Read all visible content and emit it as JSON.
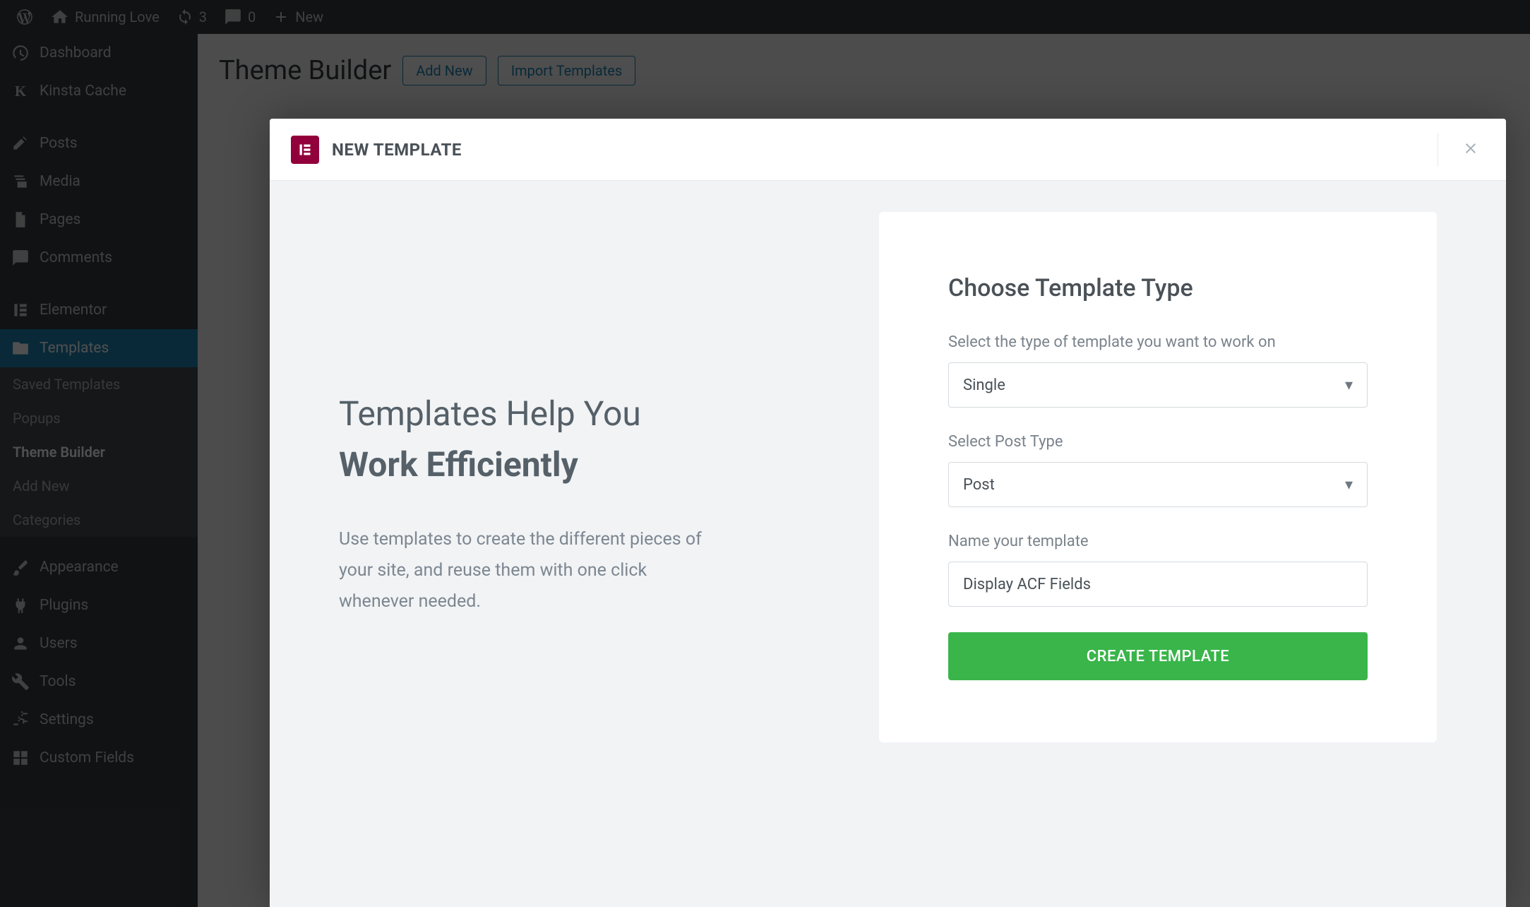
{
  "adminbar": {
    "site_name": "Running Love",
    "updates_count": "3",
    "comments_count": "0",
    "new_label": "New"
  },
  "sidebar": {
    "items": [
      {
        "label": "Dashboard",
        "icon": "dashboard-icon"
      },
      {
        "label": "Kinsta Cache",
        "icon": "kinsta-icon"
      },
      {
        "label": "Posts",
        "icon": "pin-icon"
      },
      {
        "label": "Media",
        "icon": "media-icon"
      },
      {
        "label": "Pages",
        "icon": "page-icon"
      },
      {
        "label": "Comments",
        "icon": "comment-icon"
      },
      {
        "label": "Elementor",
        "icon": "elementor-icon"
      },
      {
        "label": "Templates",
        "icon": "folder-icon"
      },
      {
        "label": "Appearance",
        "icon": "brush-icon"
      },
      {
        "label": "Plugins",
        "icon": "plug-icon"
      },
      {
        "label": "Users",
        "icon": "user-icon"
      },
      {
        "label": "Tools",
        "icon": "wrench-icon"
      },
      {
        "label": "Settings",
        "icon": "sliders-icon"
      },
      {
        "label": "Custom Fields",
        "icon": "grid-icon"
      }
    ],
    "sub": {
      "saved": "Saved Templates",
      "popups": "Popups",
      "theme_builder": "Theme Builder",
      "add_new": "Add New",
      "categories": "Categories"
    }
  },
  "page": {
    "title": "Theme Builder",
    "add_new": "Add New",
    "import": "Import Templates"
  },
  "modal": {
    "title": "NEW TEMPLATE",
    "hero_line1": "Templates Help You",
    "hero_line2": "Work Efficiently",
    "hero_desc": "Use templates to create the different pieces of your site, and reuse them with one click whenever needed.",
    "form_title": "Choose Template Type",
    "type_label": "Select the type of template you want to work on",
    "type_value": "Single",
    "posttype_label": "Select Post Type",
    "posttype_value": "Post",
    "name_label": "Name your template",
    "name_value": "Display ACF Fields",
    "create_label": "CREATE TEMPLATE"
  }
}
